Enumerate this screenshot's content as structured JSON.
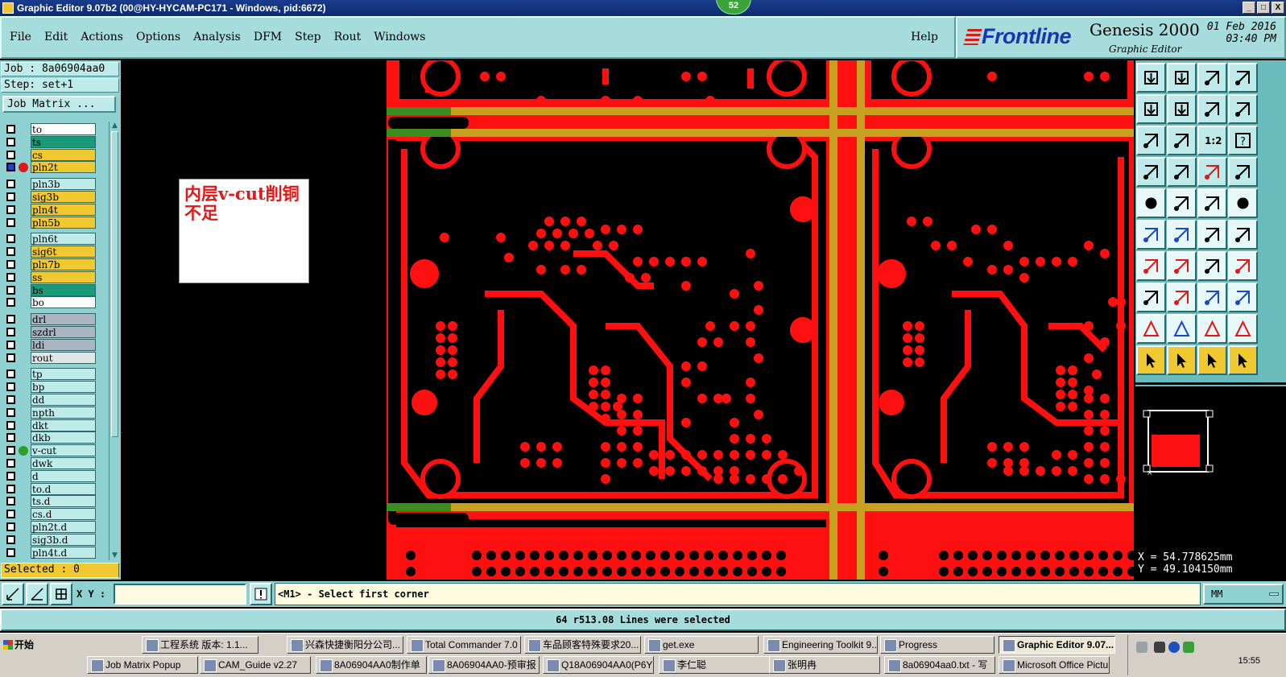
{
  "window": {
    "title": "Graphic Editor 9.07b2 (00@HY-HYCAM-PC171 - Windows, pid:6672)",
    "badge": "52",
    "controls": [
      "_",
      "□",
      "X"
    ]
  },
  "menu": {
    "items": [
      "File",
      "Edit",
      "Actions",
      "Options",
      "Analysis",
      "DFM",
      "Step",
      "Rout",
      "Windows"
    ],
    "help": "Help"
  },
  "brand": {
    "logo": "Frontline",
    "product": "Genesis 2000",
    "subtitle": "Graphic Editor",
    "date": "01 Feb 2016",
    "time": "03:40 PM"
  },
  "job": {
    "job_label": "Job : 8a06904aa0",
    "step_label": "Step: set+1",
    "matrix_button": "Job Matrix ..."
  },
  "layers": [
    {
      "name": "to",
      "color": "#ffffff",
      "checked": false,
      "dot": null
    },
    {
      "name": "ts",
      "color": "#1a9a78",
      "checked": false,
      "dot": null
    },
    {
      "name": "cs",
      "color": "#f0c830",
      "checked": false,
      "dot": null
    },
    {
      "name": "pln2t",
      "color": "#f0c830",
      "checked": true,
      "dot": "#e01818"
    },
    {
      "name": "pln3b",
      "color": "#bfeaea",
      "checked": false,
      "dot": null
    },
    {
      "name": "sig3b",
      "color": "#f0c830",
      "checked": false,
      "dot": null
    },
    {
      "name": "pln4t",
      "color": "#f0c830",
      "checked": false,
      "dot": null
    },
    {
      "name": "pln5b",
      "color": "#f0c830",
      "checked": false,
      "dot": null
    },
    {
      "name": "pln6t",
      "color": "#bfeaea",
      "checked": false,
      "dot": null
    },
    {
      "name": "sig6t",
      "color": "#f0c830",
      "checked": false,
      "dot": null
    },
    {
      "name": "pln7b",
      "color": "#f0c830",
      "checked": false,
      "dot": null
    },
    {
      "name": "ss",
      "color": "#f0c830",
      "checked": false,
      "dot": null
    },
    {
      "name": "bs",
      "color": "#1a9a78",
      "checked": false,
      "dot": null
    },
    {
      "name": "bo",
      "color": "#ffffff",
      "checked": false,
      "dot": null
    },
    {
      "name": "drl",
      "color": "#a9b6c2",
      "checked": false,
      "dot": null
    },
    {
      "name": "szdrl",
      "color": "#a9b6c2",
      "checked": false,
      "dot": null
    },
    {
      "name": "ldi",
      "color": "#a9b6c2",
      "checked": false,
      "dot": null
    },
    {
      "name": "rout",
      "color": "#dfe6e6",
      "checked": false,
      "dot": null
    },
    {
      "name": "tp",
      "color": "#bfeaea",
      "checked": false,
      "dot": null
    },
    {
      "name": "bp",
      "color": "#bfeaea",
      "checked": false,
      "dot": null
    },
    {
      "name": "dd",
      "color": "#bfeaea",
      "checked": false,
      "dot": null
    },
    {
      "name": "npth",
      "color": "#bfeaea",
      "checked": false,
      "dot": null
    },
    {
      "name": "dkt",
      "color": "#bfeaea",
      "checked": false,
      "dot": null
    },
    {
      "name": "dkb",
      "color": "#bfeaea",
      "checked": false,
      "dot": null
    },
    {
      "name": "v-cut",
      "color": "#bfeaea",
      "checked": false,
      "dot": "#2aa02a"
    },
    {
      "name": "dwk",
      "color": "#bfeaea",
      "checked": false,
      "dot": null
    },
    {
      "name": "d",
      "color": "#bfeaea",
      "checked": false,
      "dot": null
    },
    {
      "name": "to.d",
      "color": "#bfeaea",
      "checked": false,
      "dot": null
    },
    {
      "name": "ts.d",
      "color": "#bfeaea",
      "checked": false,
      "dot": null
    },
    {
      "name": "cs.d",
      "color": "#bfeaea",
      "checked": false,
      "dot": null
    },
    {
      "name": "pln2t.d",
      "color": "#bfeaea",
      "checked": false,
      "dot": null
    },
    {
      "name": "sig3b.d",
      "color": "#bfeaea",
      "checked": false,
      "dot": null
    },
    {
      "name": "pln4t.d",
      "color": "#bfeaea",
      "checked": false,
      "dot": null
    }
  ],
  "selected_label": "Selected : 0",
  "annotation": "内层v-cut削铜不足",
  "coords": {
    "x": "X =  54.778625mm",
    "y": "Y =  49.104150mm"
  },
  "command": {
    "xy_label": "X Y :",
    "xy_value": "",
    "prompt": "<M1> - Select first corner",
    "units": "MM"
  },
  "status": "64 r513.08 Lines were selected",
  "taskbar": {
    "start": "开始",
    "row1": [
      "工程系统  版本: 1.1...",
      "兴森快捷衡阳分公司...",
      "Total Commander 7.0 ...",
      "车品顾客特殊要求20...",
      "get.exe",
      "Engineering Toolkit 9....",
      "Progress",
      "Graphic Editor 9.07..."
    ],
    "row2": [
      "Job Matrix Popup",
      "CAM_Guide v2.27",
      "8A06904AA0制作单",
      "8A06904AA0-预审报",
      "Q18A06904AA0(P6Y",
      "李仁聪",
      "张明冉",
      "8a06904aa0.txt - 写",
      "Microsoft Office Pictu"
    ],
    "clock": "15:55"
  }
}
